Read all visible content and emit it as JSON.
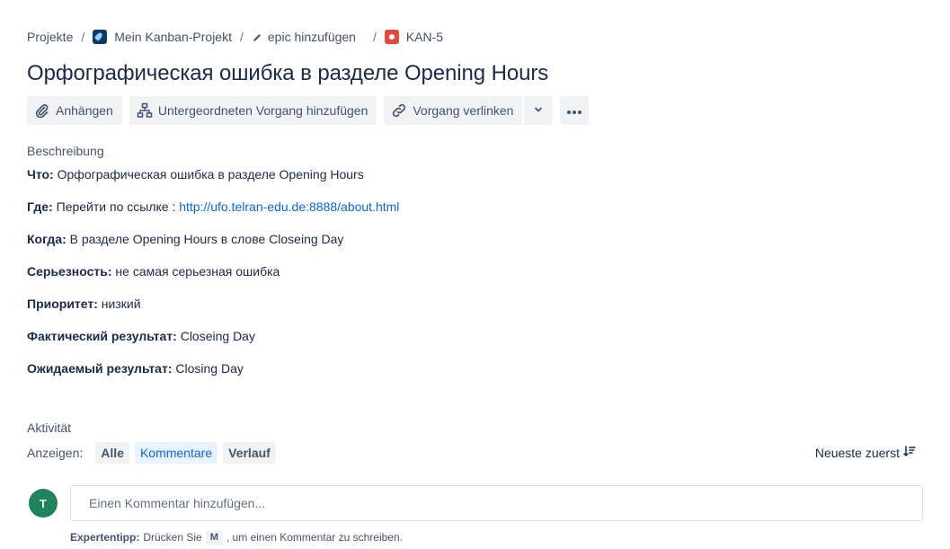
{
  "breadcrumb": {
    "projects": "Projekte",
    "sep": "/",
    "project": "Mein Kanban-Projekt",
    "epic": "epic hinzufügen",
    "issue_key": "KAN-5"
  },
  "issue": {
    "title": "Орфографическая ошибка в разделе Opening Hours"
  },
  "toolbar": {
    "attach": "Anhängen",
    "add_child": "Untergeordneten Vorgang hinzufügen",
    "link_issue": "Vorgang verlinken"
  },
  "description": {
    "label": "Beschreibung",
    "lines": [
      {
        "key": "Что:",
        "value": " Орфографическая ошибка в разделе Opening Hours"
      },
      {
        "key": "Где:",
        "value": " Перейти по ссылке : ",
        "link": "http://ufo.telran-edu.de:8888/about.html"
      },
      {
        "key": "Когда:",
        "value": " В разделе Opening Hours в слове Closeing Day"
      },
      {
        "key": "Серьезность:",
        "value": " не самая серьезная ошибка"
      },
      {
        "key": "Приоритет:",
        "value": " низкий"
      },
      {
        "key": "Фактический результат:",
        "value": " Closeing Day"
      },
      {
        "key": "Ожидаемый результат:",
        "value": " Closing Day"
      }
    ]
  },
  "activity": {
    "label": "Aktivität",
    "show_label": "Anzeigen:",
    "filters": [
      "Alle",
      "Kommentare",
      "Verlauf"
    ],
    "active_filter": "Kommentare",
    "sort_label": "Neueste zuerst"
  },
  "comment": {
    "avatar_initial": "T",
    "placeholder": "Einen Kommentar hinzufügen...",
    "tip_bold": "Expertentipp:",
    "tip_before": "Drücken Sie",
    "tip_key": "M",
    "tip_after": ", um einen Kommentar zu schreiben."
  },
  "colors": {
    "accent": "#0c66e4",
    "avatar": "#1f845a",
    "bug": "#e5493a"
  }
}
